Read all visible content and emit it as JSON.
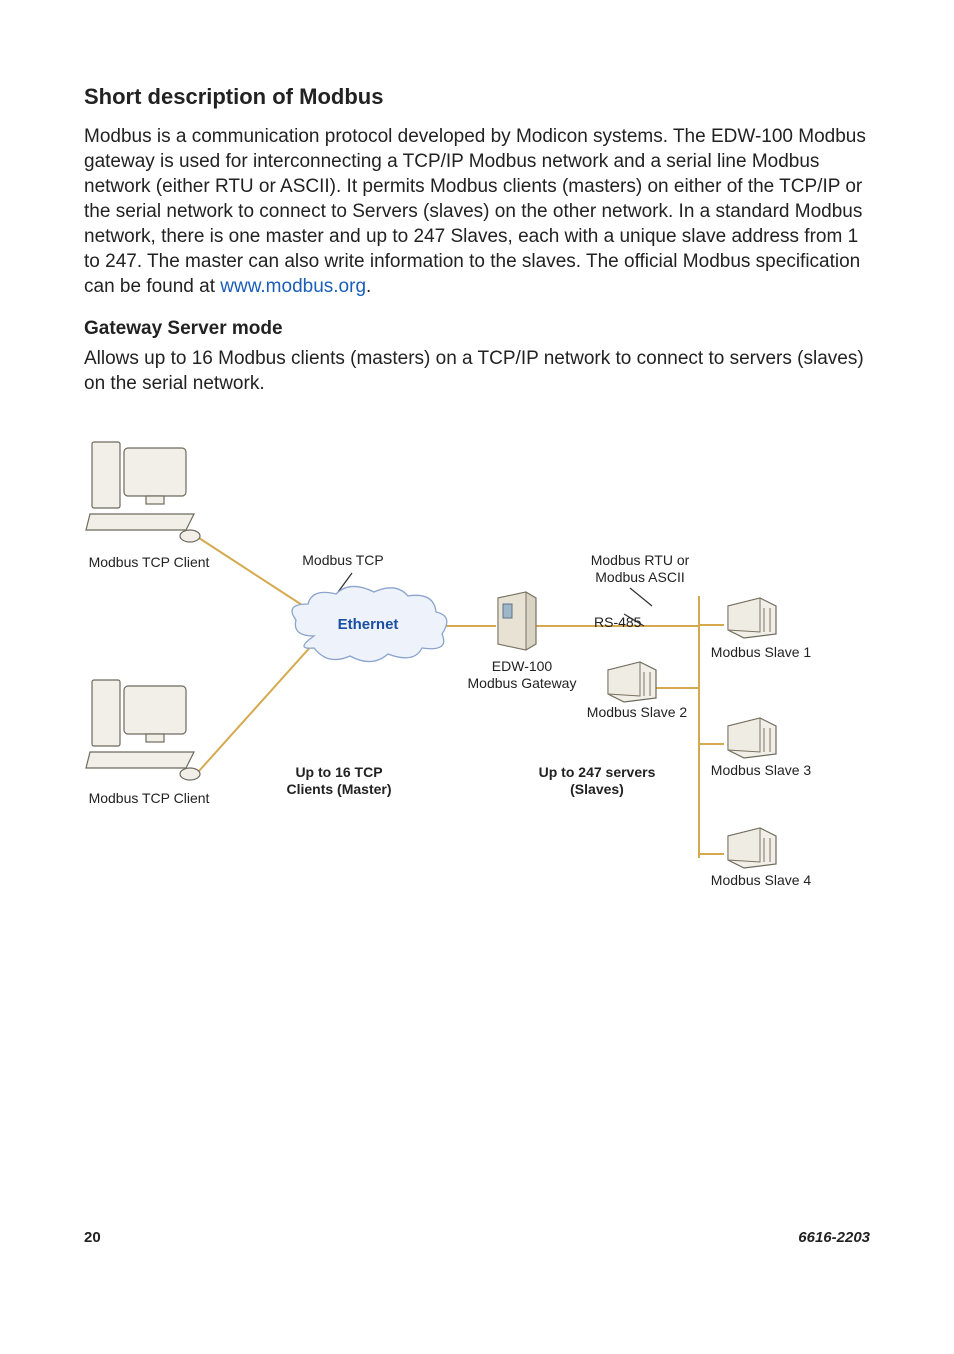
{
  "section_title": "Short description of Modbus",
  "body_before_link": "Modbus is a communication protocol developed by Modicon systems. The EDW-100 Modbus gateway is used for interconnecting a TCP/IP Modbus network and a serial line Modbus network (either RTU or ASCII). It permits Modbus clients (masters) on either of the TCP/IP or the serial network to connect to Servers (slaves) on the other network. In a standard Modbus network, there is one master and up to 247 Slaves, each with a unique slave address from 1 to 247. The master can also write information to the slaves. The official Modbus specification can be found at ",
  "link_text": "www.modbus.org",
  "body_after_link": ".",
  "sub_title": "Gateway Server mode",
  "sub_body": "Allows up to 16 Modbus clients (masters) on a TCP/IP network to connect to servers (slaves) on the serial network.",
  "diagram": {
    "client_top": "Modbus TCP Client",
    "client_bottom": "Modbus TCP Client",
    "modbus_tcp": "Modbus TCP",
    "ethernet": "Ethernet",
    "edw100_line1": "EDW-100",
    "edw100_line2": "Modbus Gateway",
    "rtu_line1": "Modbus RTU or",
    "rtu_line2": "Modbus ASCII",
    "rs485": "RS-485",
    "clients_line1": "Up to 16 TCP",
    "clients_line2": "Clients (Master)",
    "servers_line1": "Up to 247 servers",
    "servers_line2": "(Slaves)",
    "slave1": "Modbus Slave 1",
    "slave2": "Modbus Slave 2",
    "slave3": "Modbus Slave 3",
    "slave4": "Modbus Slave 4"
  },
  "footer": {
    "page": "20",
    "doc": "6616-2203"
  }
}
